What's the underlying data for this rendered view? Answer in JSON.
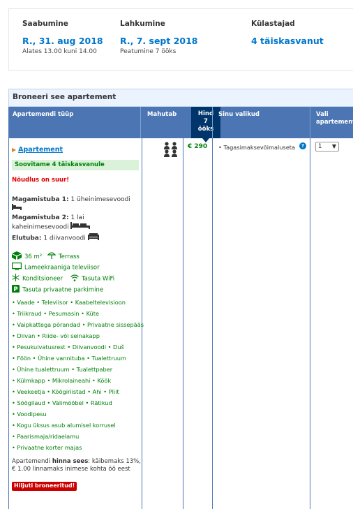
{
  "summary": {
    "checkin": {
      "label": "Saabumine",
      "date": "R., 31. aug 2018",
      "time": "Alates 13.00 kuni 14.00"
    },
    "checkout": {
      "label": "Lahkumine",
      "date": "R., 7. sept 2018",
      "nights": "Peatumine 7 ööks"
    },
    "guests": {
      "label": "Külastajad",
      "value": "4 täiskasvanut"
    }
  },
  "booking": {
    "title": "Broneeri see apartement",
    "headers": {
      "type": "Apartemendi tüüp",
      "capacity": "Mahutab",
      "price_line1": "Hind",
      "price_line2": "7",
      "price_line3": "ööks",
      "options": "Sinu valikud",
      "select_line1": "Vali",
      "select_line2": "apartement"
    },
    "apartment": {
      "name": "Apartement",
      "recommend": "Soovitame 4 täiskasvanule",
      "demand": "Nõudlus on suur!",
      "bedroom1_label": "Magamistuba 1:",
      "bedroom1_value": "1 üheinimesevoodi",
      "bedroom2_label": "Magamistuba 2:",
      "bedroom2_value_a": "1 lai",
      "bedroom2_value_b": "kaheinimesevoodi",
      "living_label": "Elutuba:",
      "living_value": "1 diivanvoodi",
      "area": "36 m²",
      "terrace": "Terrass",
      "tv": "Lameekraaniga televiisor",
      "aircon": "Konditsioneer",
      "wifi": "Tasuta WiFi",
      "parking": "Tasuta privaatne parkimine",
      "amenity_lines": [
        "• Vaade  • Televiisor  • Kaabeltelevisioon",
        "• Triikraud  • Pesumasin  • Küte",
        "• Vaipkattega põrandad  • Privaatne sissepääs",
        "• Diivan  • Riide- või seinakapp",
        "• Pesukuivatusrest  • Diivanvoodi  • Duš",
        "• Föön  • Ühine vannituba  • Tualettruum",
        "• Ühine tualettruum  • Tualettpaber",
        "• Külmkapp  • Mikrolaineahi  • Köök",
        "• Veekeetja  • Köögiriistad  • Ahi  • Pliit",
        "• Söögilaud  • Välimööbel  • Rätikud",
        "• Voodipesu",
        "• Kogu üksus asub alumisel korrusel",
        "• Paarismaja/ridaelamu",
        "• Privaatne korter majas"
      ],
      "included_a": "Apartemendi",
      "included_b": "hinna sees",
      "included_c": ": käibemaks 13%, € 1.00 linnamaks inimese kohta öö eest",
      "reserved": "Hiljuti broneeritud!",
      "price": "€ 290",
      "policy": "Tagasimaksevõimaluseta",
      "select_value": "1"
    }
  },
  "colors": {
    "link": "#0077cc",
    "header_bg": "#4b76b3",
    "price_header_bg": "#00356b",
    "green": "#008009",
    "red": "#cc0000"
  }
}
